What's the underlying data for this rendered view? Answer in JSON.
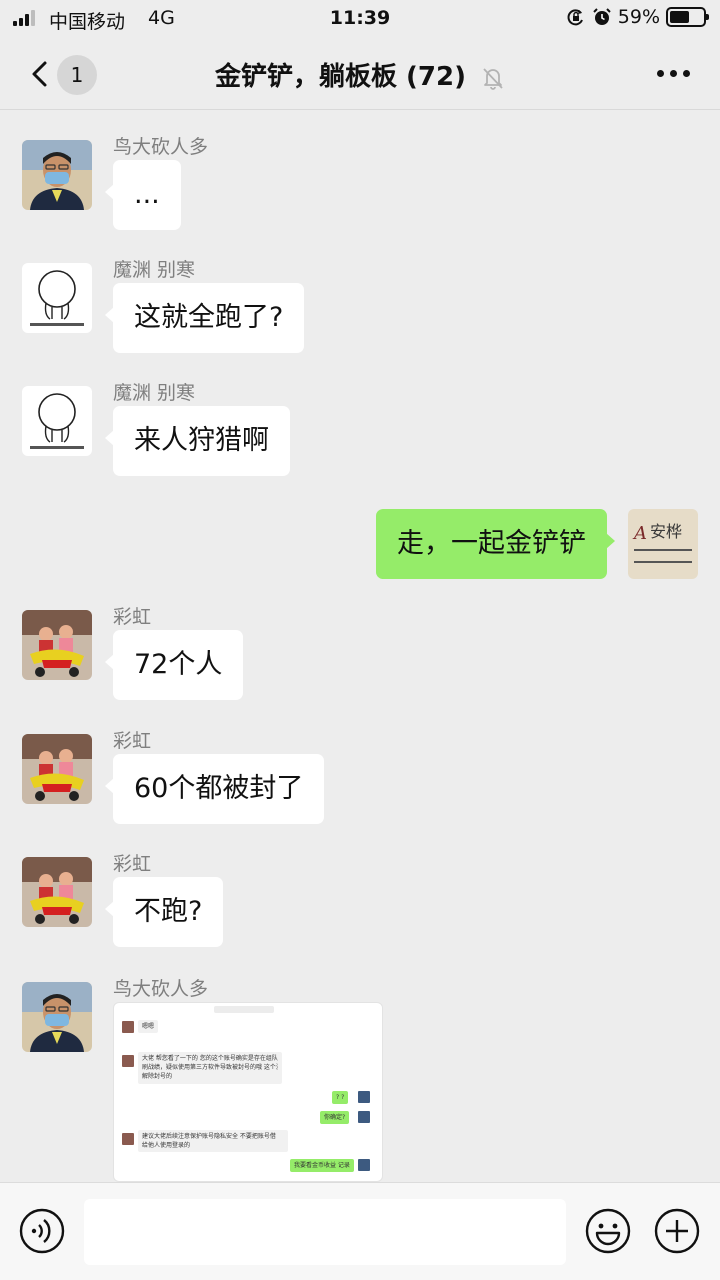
{
  "status_bar": {
    "carrier": "中国移动",
    "network": "4G",
    "time": "11:39",
    "battery": "59%",
    "battery_level": 0.59,
    "icons": [
      "signal-icon",
      "orientation-lock-icon",
      "alarm-icon",
      "battery-icon"
    ]
  },
  "header": {
    "unread_count": "1",
    "title": "金铲铲，躺板板 (72)",
    "icons": [
      "back-arrow-icon",
      "mute-bell-icon",
      "more-dots-icon"
    ]
  },
  "messages": [
    {
      "direction": "in",
      "sender": "鸟大砍人多",
      "avatar": "man-with-mask",
      "text": "..."
    },
    {
      "direction": "in",
      "sender": "魔渊 别寒",
      "avatar": "sketch-character",
      "text": "这就全跑了?"
    },
    {
      "direction": "in",
      "sender": "魔渊 别寒",
      "avatar": "sketch-character",
      "text": "来人狩猎啊"
    },
    {
      "direction": "out",
      "avatar": "anhua-logo",
      "text": "走，一起金铲铲"
    },
    {
      "direction": "in",
      "sender": "彩虹",
      "avatar": "children-on-tricycle",
      "text": "72个人"
    },
    {
      "direction": "in",
      "sender": "彩虹",
      "avatar": "children-on-tricycle",
      "text": "60个都被封了"
    },
    {
      "direction": "in",
      "sender": "彩虹",
      "avatar": "children-on-tricycle",
      "text": "不跑?"
    },
    {
      "direction": "in",
      "sender": "鸟大砍人多",
      "avatar": "man-with-mask",
      "type": "image",
      "image_lines": [
        "嗯嗯",
        "大佬  帮您看了一下的  您的这个账号确实是存在组队",
        "刷战绩，疑似使用第三方软件导致被封号的哦  这个没办法",
        "解除封号的",
        "? ?",
        "你确定?",
        "建议大佬后续注意保护账号隐私安全  不要把账号借",
        "给他人使用登录的",
        "我要看金币收益 记录"
      ]
    }
  ],
  "input_bar": {
    "icons": [
      "voice-icon",
      "emoji-icon",
      "plus-icon"
    ]
  },
  "avatar_logo_text": "安桦"
}
